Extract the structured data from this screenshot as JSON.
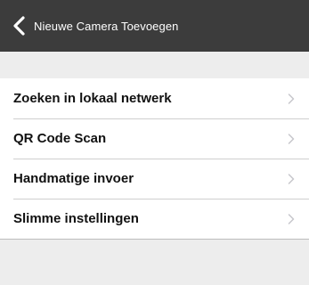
{
  "navbar": {
    "title": "Nieuwe Camera Toevoegen",
    "back_icon": "chevron-left-icon"
  },
  "menu": {
    "items": [
      {
        "label": "Zoeken in lokaal netwerk",
        "icon": "chevron-right-icon"
      },
      {
        "label": "QR Code Scan",
        "icon": "chevron-right-icon"
      },
      {
        "label": "Handmatige invoer",
        "icon": "chevron-right-icon"
      },
      {
        "label": "Slimme instellingen",
        "icon": "chevron-right-icon"
      }
    ]
  },
  "colors": {
    "navbar_bg": "#3c3c3c",
    "page_bg": "#ededed",
    "row_bg": "#ffffff",
    "chevron": "#c7c7cc"
  }
}
